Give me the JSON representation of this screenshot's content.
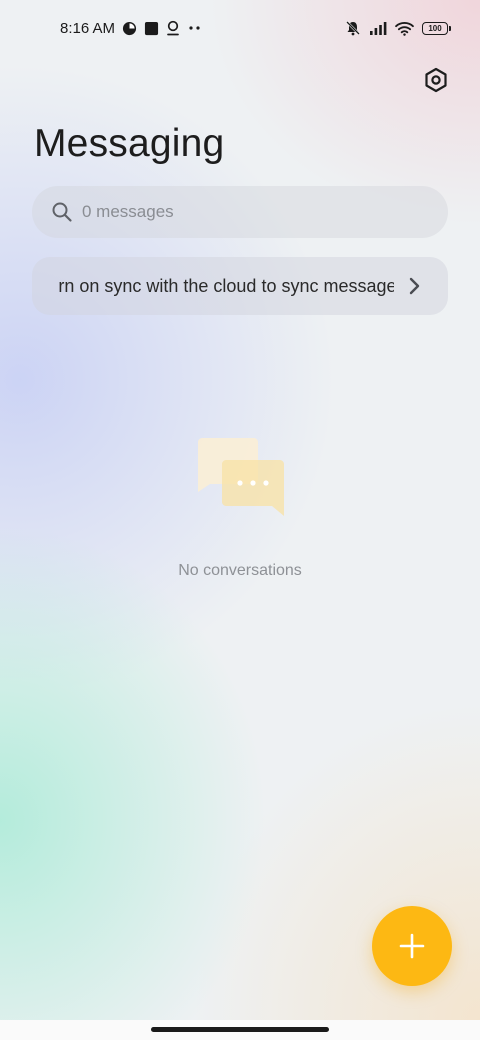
{
  "status_bar": {
    "time": "8:16 AM",
    "battery_level": "100",
    "icons": [
      "pie-notification-icon",
      "square-notification-icon",
      "location-pin-icon",
      "more-dots-icon",
      "mute-icon",
      "signal-icon",
      "wifi-icon",
      "battery-icon"
    ]
  },
  "header": {
    "title": "Messaging",
    "settings_icon": "hexagon-settings-icon"
  },
  "search": {
    "placeholder": "0 messages",
    "value": "",
    "icon": "search-icon"
  },
  "sync_banner": {
    "text": "Turn on sync with the cloud to sync messages",
    "icon": "chevron-right-icon"
  },
  "empty_state": {
    "illustration": "chat-bubbles-icon",
    "label": "No conversations"
  },
  "fab": {
    "icon": "plus-icon",
    "color": "#fdb813"
  },
  "colors": {
    "accent": "#fdb813",
    "title": "#1d1d1d",
    "muted": "#8e9196"
  }
}
